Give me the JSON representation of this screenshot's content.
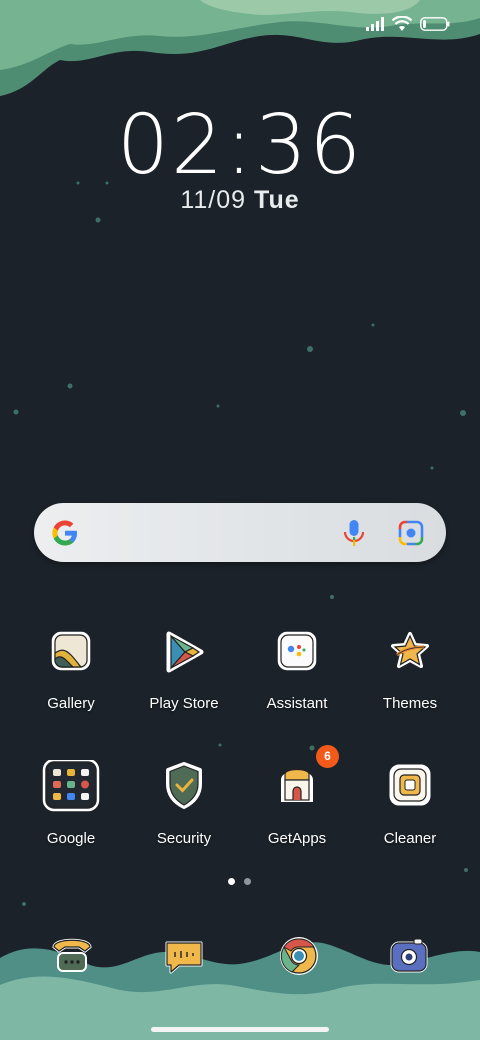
{
  "status_bar": {
    "signal_icon": "signal-icon",
    "wifi_icon": "wifi-icon",
    "battery_icon": "battery-icon"
  },
  "clock": {
    "time": "02:36",
    "date": "11/09",
    "weekday": "Tue"
  },
  "search_bar": {
    "google_icon": "google-g-icon",
    "mic_icon": "microphone-icon",
    "lens_icon": "google-lens-icon"
  },
  "apps": [
    {
      "label": "Gallery",
      "icon": "gallery-icon"
    },
    {
      "label": "Play Store",
      "icon": "play-store-icon"
    },
    {
      "label": "Assistant",
      "icon": "assistant-icon"
    },
    {
      "label": "Themes",
      "icon": "themes-icon"
    },
    {
      "label": "Google",
      "icon": "google-folder-icon"
    },
    {
      "label": "Security",
      "icon": "security-shield-icon"
    },
    {
      "label": "GetApps",
      "icon": "getapps-icon",
      "badge": "6"
    },
    {
      "label": "Cleaner",
      "icon": "cleaner-icon"
    }
  ],
  "page_indicator": {
    "pages": 2,
    "current": 1
  },
  "dock": [
    {
      "icon": "phone-icon"
    },
    {
      "icon": "messages-icon"
    },
    {
      "icon": "chrome-icon"
    },
    {
      "icon": "camera-icon"
    }
  ],
  "colors": {
    "background": "#1b2229",
    "grass": "#7fb7a5",
    "badge": "#f25a1c"
  }
}
